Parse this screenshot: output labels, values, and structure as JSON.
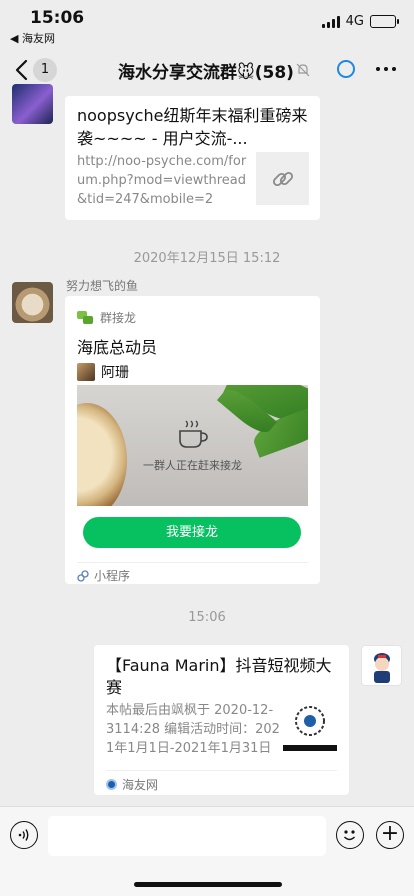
{
  "status_bar": {
    "time": "15:06",
    "back_app": "◀ 海友网",
    "network": "4G"
  },
  "nav": {
    "unread_count": "1",
    "title": "海水分享交流群🐭(58)",
    "icons": [
      "back-chevron-icon",
      "mute-icon",
      "loading-ring-icon",
      "more-icon"
    ]
  },
  "messages": [
    {
      "type": "link",
      "title": "noopsyche纽斯年末福利重磅来袭~~~~ - 用户交流-...",
      "description": "http://noo-psyche.com/forum.php?mod=viewthread&tid=247&mobile=2",
      "thumb_icon": "link-icon"
    },
    {
      "type": "timestamp",
      "text": "2020年12月15日 15:12"
    },
    {
      "type": "mini_program",
      "sender": "努力想飞的鱼",
      "source_label": "群接龙",
      "title": "海底总动员",
      "owner": "阿珊",
      "image_caption": "一群人正在赶来接龙",
      "button_label": "我要接龙",
      "footer": "小程序"
    },
    {
      "type": "timestamp",
      "text": "15:06"
    },
    {
      "type": "article",
      "title": "【Fauna Marin】抖音短视频大赛",
      "description": "本帖最后由飒枫于 2020-12-3114:28 编辑活动时间：2021年1月1日-2021年1月31日",
      "footer": "海友网"
    }
  ],
  "colors": {
    "background": "#ededed",
    "accent_green": "#07c160",
    "ring_blue": "#1e88e5"
  }
}
